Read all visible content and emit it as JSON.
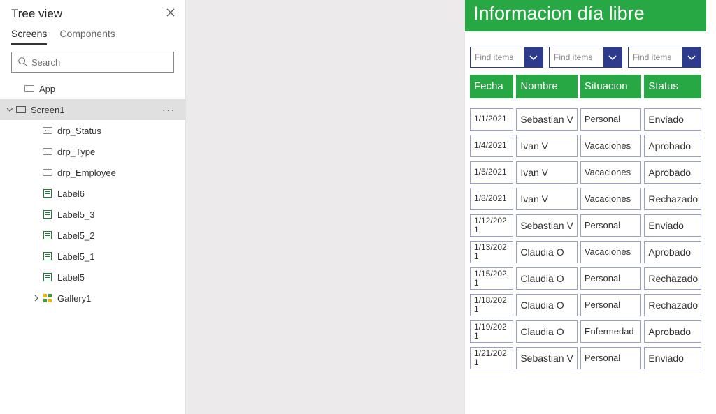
{
  "tree": {
    "title": "Tree view",
    "tabs": {
      "screens": "Screens",
      "components": "Components"
    },
    "search_placeholder": "Search",
    "app_label": "App",
    "screen_label": "Screen1",
    "items": [
      {
        "label": "drp_Status",
        "icon": "drop"
      },
      {
        "label": "drp_Type",
        "icon": "drop"
      },
      {
        "label": "drp_Employee",
        "icon": "drop"
      },
      {
        "label": "Label6",
        "icon": "label"
      },
      {
        "label": "Label5_3",
        "icon": "label"
      },
      {
        "label": "Label5_2",
        "icon": "label"
      },
      {
        "label": "Label5_1",
        "icon": "label"
      },
      {
        "label": "Label5",
        "icon": "label"
      },
      {
        "label": "Gallery1",
        "icon": "gallery",
        "expandable": true
      }
    ]
  },
  "app": {
    "title": "Informacion día libre",
    "filter_placeholder": "Find items",
    "headers": {
      "fecha": "Fecha",
      "nombre": "Nombre",
      "situacion": "Situacion",
      "status": "Status"
    },
    "rows": [
      {
        "fecha": "1/1/2021",
        "nombre": "Sebastian V",
        "situacion": "Personal",
        "status": "Enviado"
      },
      {
        "fecha": "1/4/2021",
        "nombre": "Ivan V",
        "situacion": "Vacaciones",
        "status": "Aprobado"
      },
      {
        "fecha": "1/5/2021",
        "nombre": "Ivan V",
        "situacion": "Vacaciones",
        "status": "Aprobado"
      },
      {
        "fecha": "1/8/2021",
        "nombre": "Ivan V",
        "situacion": "Vacaciones",
        "status": "Rechazado"
      },
      {
        "fecha": "1/12/2021",
        "nombre": "Sebastian V",
        "situacion": "Personal",
        "status": "Enviado"
      },
      {
        "fecha": "1/13/2021",
        "nombre": "Claudia O",
        "situacion": "Vacaciones",
        "status": "Aprobado"
      },
      {
        "fecha": "1/15/2021",
        "nombre": "Claudia O",
        "situacion": "Personal",
        "status": "Rechazado"
      },
      {
        "fecha": "1/18/2021",
        "nombre": "Claudia O",
        "situacion": "Personal",
        "status": "Rechazado"
      },
      {
        "fecha": "1/19/2021",
        "nombre": "Claudia O",
        "situacion": "Enfermedad",
        "status": "Aprobado"
      },
      {
        "fecha": "1/21/2021",
        "nombre": "Sebastian V",
        "situacion": "Personal",
        "status": "Enviado"
      }
    ]
  }
}
